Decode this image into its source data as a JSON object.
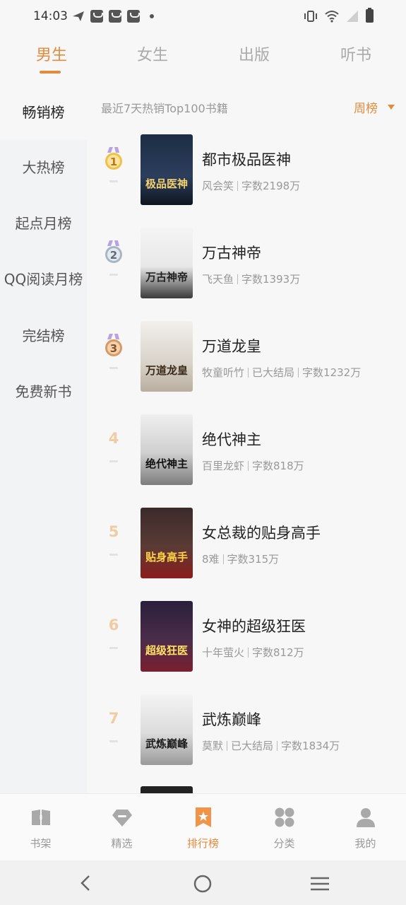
{
  "status_bar": {
    "time": "14:03",
    "icons": [
      "send-icon",
      "bag-icon",
      "bag-icon",
      "bag-icon",
      "dot-icon",
      "vibrate-icon",
      "wifi-icon",
      "signal-icon",
      "battery-icon"
    ]
  },
  "top_tabs": [
    "男生",
    "女生",
    "出版",
    "听书"
  ],
  "active_top_tab": "男生",
  "sidebar": {
    "items": [
      "畅销榜",
      "大热榜",
      "起点月榜",
      "QQ阅读月榜",
      "完结榜",
      "免费新书"
    ],
    "active": "畅销榜"
  },
  "list": {
    "header": "最近7天热销Top100书籍",
    "period": "周榜",
    "books": [
      {
        "rank": "1",
        "title": "都市极品医神",
        "meta": [
          "风会笑",
          "字数2198万"
        ],
        "cover_text": "极品医神"
      },
      {
        "rank": "2",
        "title": "万古神帝",
        "meta": [
          "飞天鱼",
          "字数1393万"
        ],
        "cover_text": "万古神帝"
      },
      {
        "rank": "3",
        "title": "万道龙皇",
        "meta": [
          "牧童听竹",
          "已大结局",
          "字数1232万"
        ],
        "cover_text": "万道龙皇"
      },
      {
        "rank": "4",
        "title": "绝代神主",
        "meta": [
          "百里龙虾",
          "字数818万"
        ],
        "cover_text": "绝代神主"
      },
      {
        "rank": "5",
        "title": "女总裁的贴身高手",
        "meta": [
          "8难",
          "字数315万"
        ],
        "cover_text": "贴身高手"
      },
      {
        "rank": "6",
        "title": "女神的超级狂医",
        "meta": [
          "十年萤火",
          "字数812万"
        ],
        "cover_text": "超级狂医"
      },
      {
        "rank": "7",
        "title": "武炼巅峰",
        "meta": [
          "莫默",
          "已大结局",
          "字数1834万"
        ],
        "cover_text": "武炼巅峰"
      }
    ]
  },
  "bottom_nav": [
    {
      "label": "书架",
      "icon": "bookshelf-icon"
    },
    {
      "label": "精选",
      "icon": "featured-icon"
    },
    {
      "label": "排行榜",
      "icon": "ranking-icon"
    },
    {
      "label": "分类",
      "icon": "category-icon"
    },
    {
      "label": "我的",
      "icon": "profile-icon"
    }
  ],
  "active_bottom_nav": "排行榜",
  "system_nav": [
    "back-icon",
    "home-icon",
    "menu-icon"
  ],
  "colors": {
    "accent": "#e38b3c",
    "muted": "#999999",
    "medal_gold": "#e9a93a",
    "medal_silver": "#9aa7b8",
    "medal_bronze": "#c88a56"
  }
}
